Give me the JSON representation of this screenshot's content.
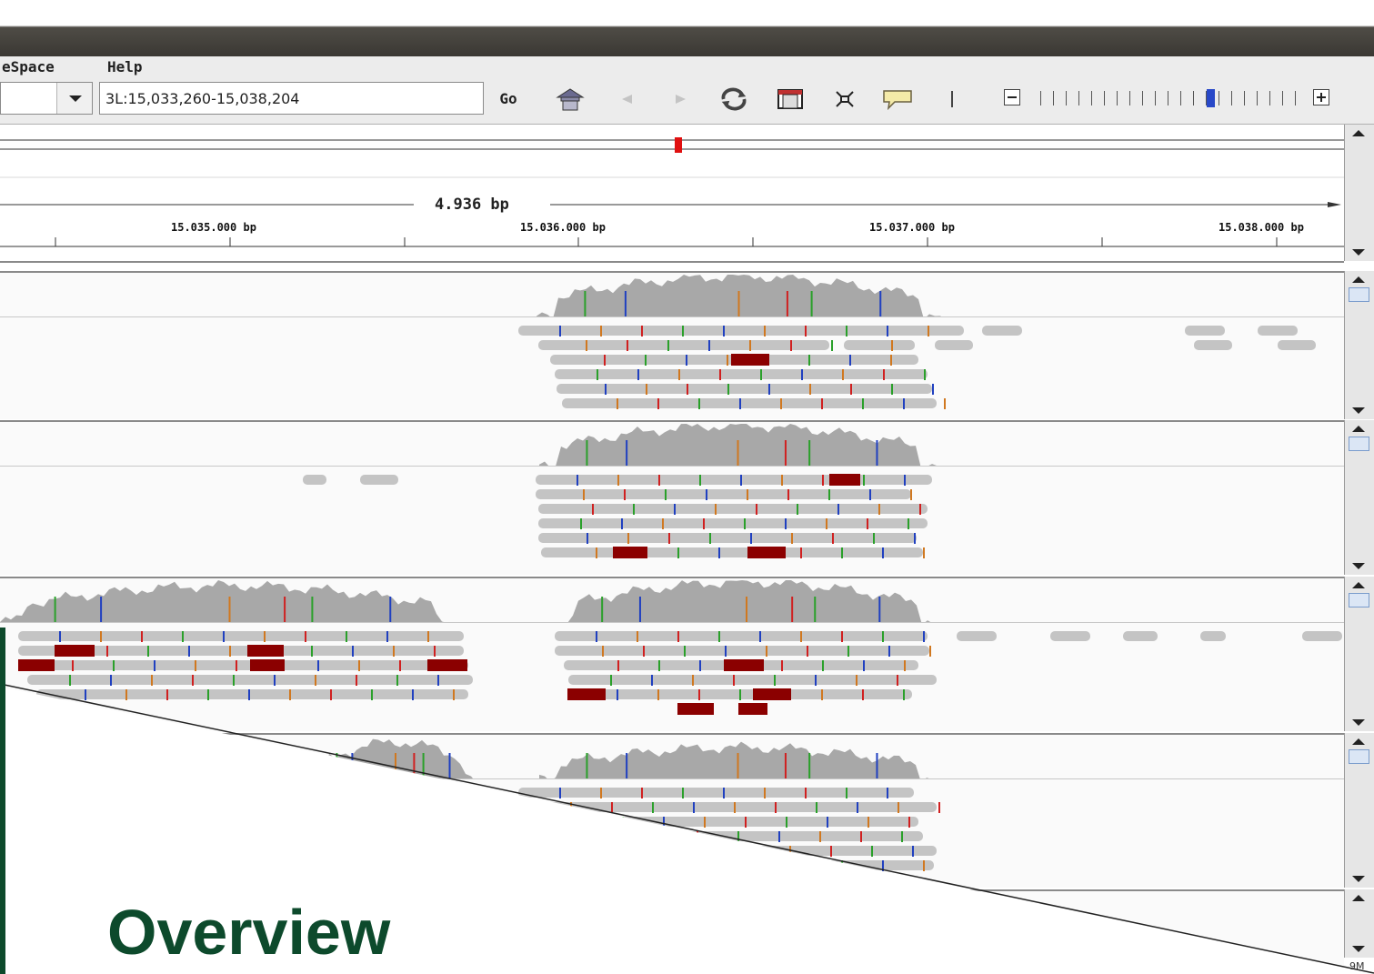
{
  "menu": [
    "eSpace",
    "Help"
  ],
  "locus": {
    "value": "3L:15,033,260-15,038,204"
  },
  "toolbar": {
    "go_label": "Go"
  },
  "icons": {
    "home": "home-icon",
    "back": "back-arrow-icon",
    "forward": "forward-arrow-icon",
    "refresh": "refresh-icon",
    "region": "region-of-interest-icon",
    "resize": "fit-to-window-icon",
    "popup": "popup-text-icon",
    "divider": "divider-icon",
    "zoom_out": "zoom-out-icon",
    "zoom_in": "zoom-in-icon"
  },
  "zoom": {
    "level": 13,
    "max": 21
  },
  "ruler": {
    "span": "4.936 bp",
    "ticks": [
      "15.035.000 bp",
      "15.036.000 bp",
      "15.037.000 bp",
      "15.038.000 bp"
    ]
  },
  "status": {
    "memory_fragment": "9M"
  },
  "slide": {
    "title": "Overview"
  },
  "colors": {
    "insertion": "#8b0000",
    "read": "#c4c4c4",
    "coverage": "#a8a8a8",
    "mismatch_A": "#2aa02a",
    "mismatch_C": "#2040c0",
    "mismatch_G": "#d07820",
    "mismatch_T": "#d02020",
    "title": "#0d4a2c"
  }
}
